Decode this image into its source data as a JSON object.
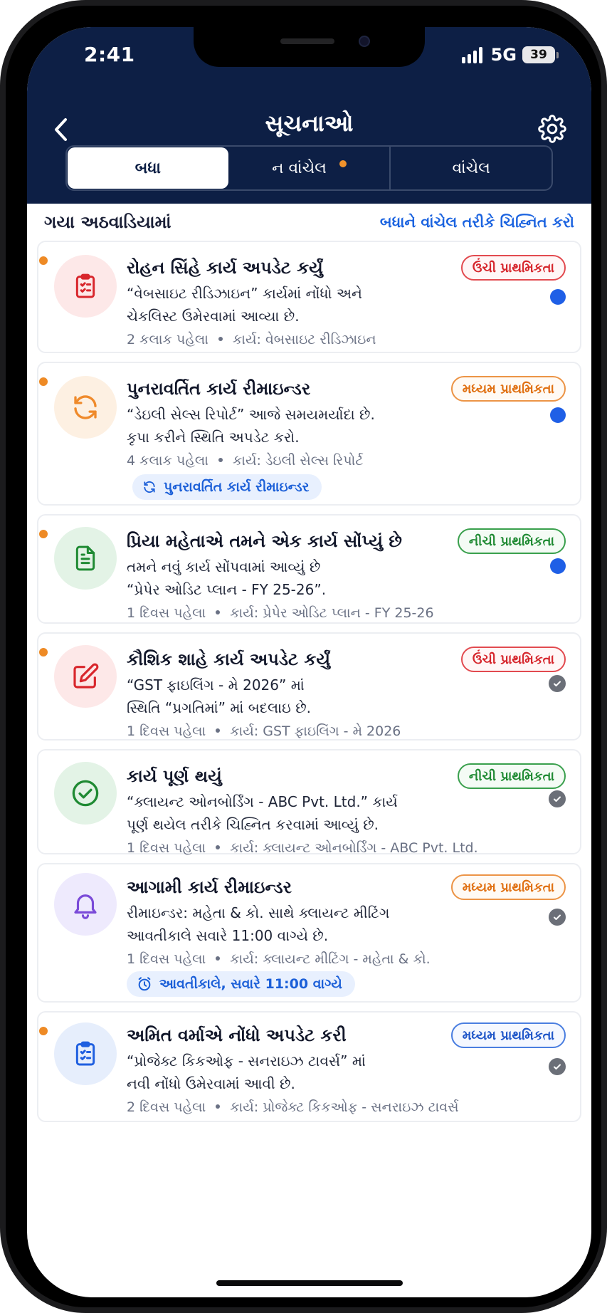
{
  "status_bar": {
    "time": "2:41",
    "network": "5G",
    "battery": "39"
  },
  "header": {
    "title": "સૂચનાઓ",
    "back_icon": "chevron-left-icon",
    "settings_icon": "gear-icon"
  },
  "tabs": [
    {
      "label": "બધા",
      "active": true
    },
    {
      "label": "ન વાંચેલ",
      "active": false,
      "has_dot": true
    },
    {
      "label": "વાંચેલ",
      "active": false
    }
  ],
  "section": {
    "title": "ગયા અઠવાડિયામાં",
    "mark_all": "બધાને વાંચેલ તરીકે ચિહ્નિત કરો"
  },
  "notifications": [
    {
      "title": "રોહન સિંહે કાર્ય અપડેટ કર્યું",
      "desc_line1": "“વેબસાઇટ રીડિઝાઇન” કાર્યમાં નોંધો અને",
      "desc_line2": "ચેકલિસ્ટ ઉમેરવામાં આવ્યા છે.",
      "time": "2 કલાક પહેલા",
      "task": "કાર્ય: વેબસાઇટ રીડિઝાઇન",
      "priority": "ઉંચી પ્રાથમિકતા",
      "icon": "clipboard-list-icon",
      "unread": true
    },
    {
      "title": "પુનરાવર્તિત કાર્ય રીમાઇન્ડર",
      "desc_line1": "“ડેઇલી સેલ્સ રિપોર્ટ” આજે સમયમર્યાદા છે.",
      "desc_line2": "કૃપા કરીને સ્થિતિ અપડેટ કરો.",
      "time": "4 કલાક પહેલા",
      "task": "કાર્ય: ડેઇલી સેલ્સ રિપોર્ટ",
      "priority": "મધ્યમ પ્રાથમિકતા",
      "icon": "refresh-icon",
      "chip": "પુનરાવર્તિત કાર્ય રીમાઇન્ડર",
      "unread": true
    },
    {
      "title": "પ્રિયા મહેતાએ તમને એક કાર્ય સોંપ્યું છે",
      "desc_line1": "તમને નવું કાર્ય સોંપવામાં આવ્યું છે",
      "desc_line2": "“પ્રેપેર ઓડિટ પ્લાન - FY 25-26”.",
      "time": "1 દિવસ પહેલા",
      "task": "કાર્ય: પ્રેપેર ઓડિટ પ્લાન - FY 25-26",
      "priority": "નીચી પ્રાથમિકતા",
      "icon": "document-icon",
      "unread": true
    },
    {
      "title": "કૌશિક શાહે કાર્ય અપડેટ કર્યું",
      "desc_line1": "“GST ફાઇલિંગ - મે 2026” માં",
      "desc_line2": "સ્થિતિ “પ્રગતિમાં” માં બદલાઇ છે.",
      "time": "1 દિવસ પહેલા",
      "task": "કાર્ય: GST ફાઇલિંગ - મે 2026",
      "priority": "ઉંચી પ્રાથમિકતા",
      "icon": "edit-icon",
      "unread": true
    },
    {
      "title": "કાર્ય પૂર્ણ થયું",
      "desc_line1": "“ક્લાયન્ટ ઓનબોર્ડિંગ - ABC Pvt. Ltd.” કાર્ય",
      "desc_line2": "પૂર્ણ થયેલ તરીકે ચિહ્નિત કરવામાં આવ્યું છે.",
      "time": "1 દિવસ પહેલા",
      "task": "કાર્ય: ક્લાયન્ટ ઓનબોર્ડિંગ - ABC Pvt. Ltd.",
      "priority": "નીચી પ્રાથમિકતા",
      "icon": "check-circle-icon",
      "unread": false
    },
    {
      "title": "આગામી કાર્ય રીમાઇન્ડર",
      "desc_line1": "રીમાઇન્ડર: મહેતા & કો. સાથે ક્લાયન્ટ મીટિંગ",
      "desc_line2": "આવતીકાલે સવારે 11:00 વાગ્યે છે.",
      "time": "1 દિવસ પહેલા",
      "task": "કાર્ય: ક્લાયન્ટ મીટિંગ - મહેતા & કો.",
      "priority": "મધ્યમ પ્રાથમિકતા",
      "icon": "bell-icon",
      "chip": "આવતીકાલે, સવારે 11:00 વાગ્યે",
      "unread": false
    },
    {
      "title": "અમિત વર્માએ નોંધો અપડેટ કરી",
      "desc_line1": "“પ્રોજેક્ટ કિકઓફ - સનરાઇઝ ટાવર્સ” માં",
      "desc_line2": "નવી નોંધો ઉમેરવામાં આવી છે.",
      "time": "2 દિવસ પહેલા",
      "task": "કાર્ય: પ્રોજેક્ટ કિકઓફ - સનરાઇઝ ટાવર્સ",
      "priority": "મધ્યમ પ્રાથમિકતા",
      "icon": "clipboard-list-icon",
      "unread": true
    }
  ],
  "colors": {
    "header_bg": "#0d1f45",
    "accent_blue": "#1b63e0",
    "unread_dot": "#ee8a25",
    "high": "#d6262c",
    "medium": "#e07012",
    "low": "#1f8a33"
  }
}
